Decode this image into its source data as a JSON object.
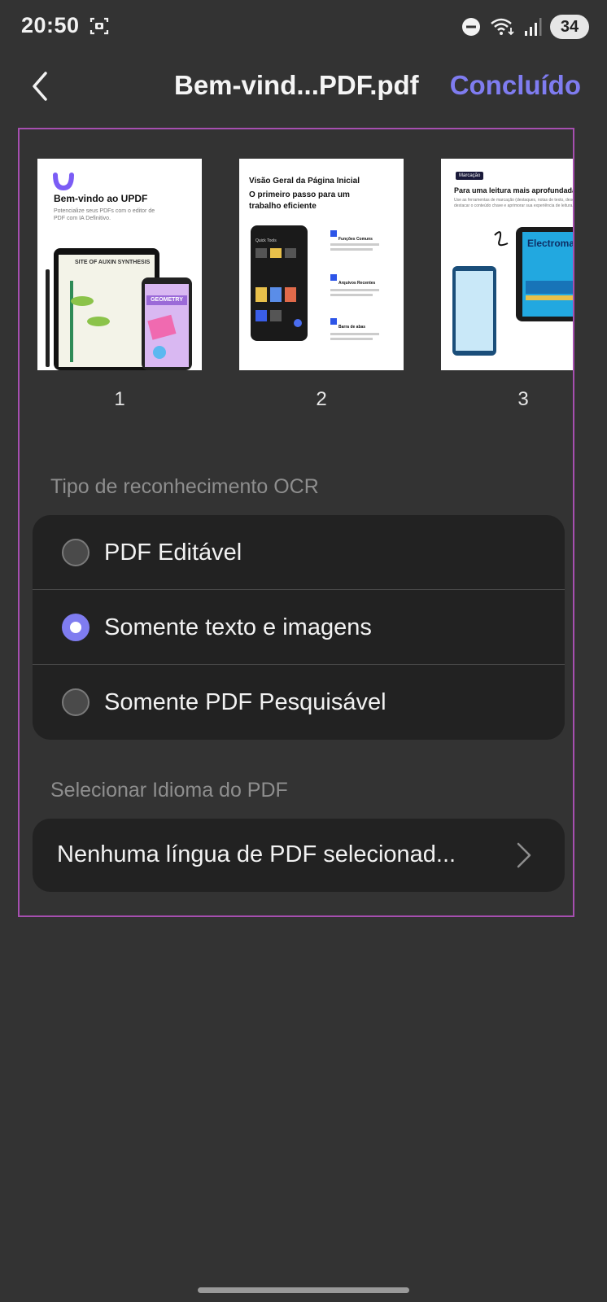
{
  "status": {
    "time": "20:50",
    "battery": "34"
  },
  "header": {
    "title": "Bem-vind...PDF.pdf",
    "done_label": "Concluído"
  },
  "thumbnails": [
    {
      "number": "1",
      "heading": "Bem-vindo ao UPDF",
      "subtext": "Potencialize seus PDFs com o editor de PDF com IA Definitivo.",
      "poster_title": "SITE OF AUXIN SYNTHESIS",
      "badge": "GEOMETRY"
    },
    {
      "number": "2",
      "heading": "Visão Geral da Página Inicial",
      "heading2": "O primeiro passo para um trabalho eficiente",
      "phone_label": "Quick Tools",
      "items": [
        "Funções Comuns",
        "Arquivos Recentes",
        "Barra de abas"
      ]
    },
    {
      "number": "3",
      "tag": "Marcação",
      "heading": "Para uma leitura mais aprofundada",
      "subtext": "Use as ferramentas de marcação (destaques, notas de texto, desenhos) para destacar o conteúdo chave e aprimorar sua experiência de leitura.",
      "tablet_title": "Electromagnetic Spectrum"
    }
  ],
  "ocr": {
    "section_label": "Tipo de reconhecimento OCR",
    "options": [
      {
        "label": "PDF Editável",
        "selected": false
      },
      {
        "label": "Somente texto e imagens",
        "selected": true
      },
      {
        "label": "Somente PDF Pesquisável",
        "selected": false
      }
    ]
  },
  "language": {
    "section_label": "Selecionar Idioma do PDF",
    "value": "Nenhuma língua de PDF selecionad..."
  },
  "colors": {
    "accent": "#7f7cf0",
    "panel_border": "#a64fb0",
    "background": "#333333",
    "card": "#222222"
  }
}
